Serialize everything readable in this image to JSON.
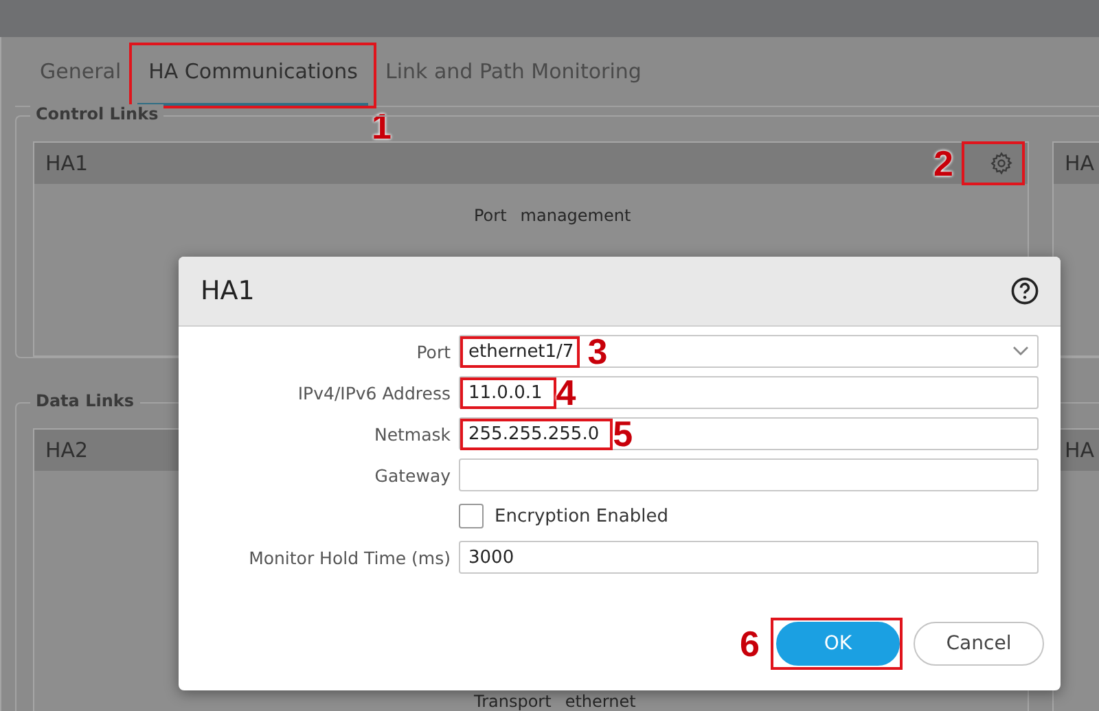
{
  "tabs": [
    {
      "label": "General",
      "selected": false
    },
    {
      "label": "HA Communications",
      "selected": true,
      "marker": {
        "label": "1"
      }
    },
    {
      "label": "Link and Path Monitoring",
      "selected": false
    }
  ],
  "sections": [
    {
      "title": "Control Links",
      "panels": [
        {
          "title": "HA1",
          "settings": {
            "marker": {
              "label": "2"
            }
          },
          "fields": [
            {
              "label": "Port",
              "value": "management"
            }
          ]
        },
        {
          "title": "HA"
        }
      ]
    },
    {
      "title": "Data Links",
      "panels": [
        {
          "title": "HA2",
          "fields": [
            {
              "label": "Transport",
              "value": "ethernet"
            }
          ]
        },
        {
          "title": "HA"
        }
      ]
    }
  ],
  "dialog": {
    "title": "HA1",
    "fields": [
      {
        "kind": "select",
        "label": "Port",
        "value": "ethernet1/7",
        "marker": {
          "label": "3"
        }
      },
      {
        "kind": "text",
        "label": "IPv4/IPv6 Address",
        "value": "11.0.0.1",
        "marker": {
          "label": "4"
        }
      },
      {
        "kind": "text",
        "label": "Netmask",
        "value": "255.255.255.0",
        "marker": {
          "label": "5"
        }
      },
      {
        "kind": "text",
        "label": "Gateway"
      },
      {
        "kind": "checkbox",
        "label": "Encryption Enabled",
        "checked": false
      },
      {
        "kind": "text",
        "label": "Monitor Hold Time (ms)",
        "value": "3000"
      }
    ],
    "buttons": [
      {
        "label": "OK",
        "kind": "primary",
        "marker": {
          "label": "6"
        }
      },
      {
        "label": "Cancel",
        "kind": "secondary"
      }
    ]
  }
}
